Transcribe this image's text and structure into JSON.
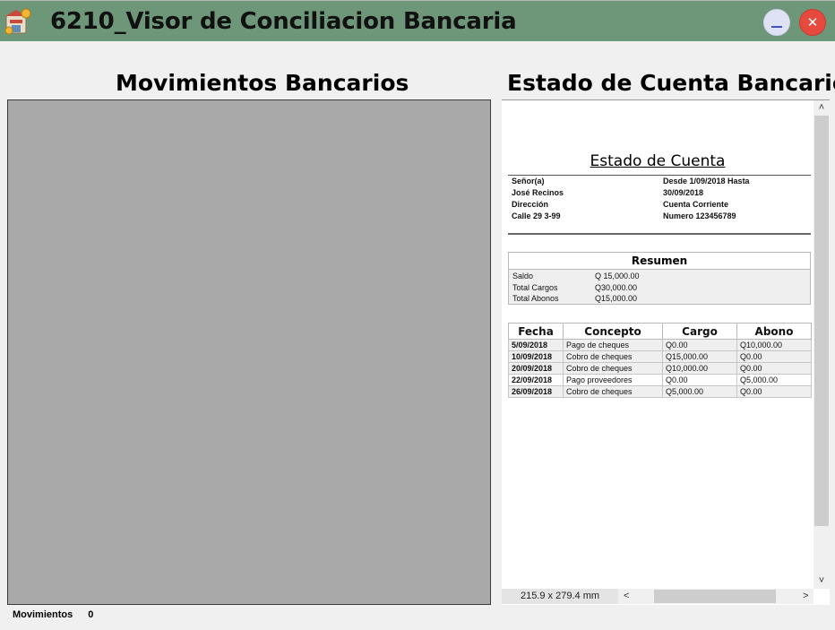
{
  "window": {
    "title": "6210_Visor de Conciliacion Bancaria",
    "minimize_symbol": "_",
    "close_symbol": "✕",
    "accent_color": "#6e977a",
    "app_icon": "bank-store-icon"
  },
  "left_panel": {
    "heading": "Movimientos Bancarios"
  },
  "right_panel": {
    "heading": "Estado de Cuenta Bancario",
    "page_size": "215.9 x 279.4 mm",
    "scroll_up": "˄",
    "scroll_down": "˅",
    "scroll_left": "<",
    "scroll_right": ">"
  },
  "statement": {
    "title": "Estado de Cuenta",
    "left_info": [
      "Señor(a)",
      "José Recinos",
      "Dirección",
      "Calle 29 3-99"
    ],
    "right_info": [
      "Desde 1/09/2018  Hasta",
      "30/09/2018",
      "Cuenta Corriente",
      "Numero 123456789"
    ],
    "summary": {
      "title": "Resumen",
      "rows": [
        {
          "label": "Saldo",
          "value": "Q 15,000.00"
        },
        {
          "label": "Total Cargos",
          "value": "Q30,000.00"
        },
        {
          "label": "Total Abonos",
          "value": "Q15,000.00"
        }
      ]
    },
    "table": {
      "headers": [
        "Fecha",
        "Concepto",
        "Cargo",
        "Abono"
      ],
      "rows": [
        [
          "5/09/2018",
          "Pago de cheques",
          "Q0.00",
          "Q10,000.00"
        ],
        [
          "10/09/2018",
          "Cobro de cheques",
          "Q15,000.00",
          "Q0.00"
        ],
        [
          "20/09/2018",
          "Cobro de cheques",
          "Q10,000.00",
          "Q0.00"
        ],
        [
          "22/09/2018",
          "Pago proveedores",
          "Q0.00",
          "Q5,000.00"
        ],
        [
          "26/09/2018",
          "Cobro de cheques",
          "Q5,000.00",
          "Q0.00"
        ]
      ]
    }
  },
  "status_bar": {
    "label": "Movimientos",
    "count": "0"
  }
}
